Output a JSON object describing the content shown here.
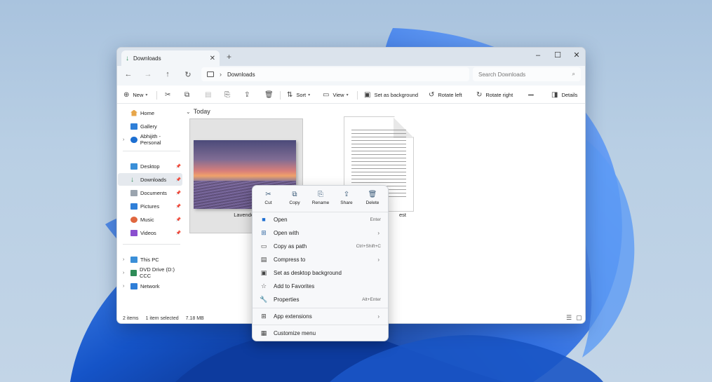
{
  "window": {
    "tab_title": "Downloads",
    "close_tab": "✕",
    "new_tab": "+",
    "minimize": "–",
    "maximize": "☐",
    "close": "✕"
  },
  "nav": {
    "back": "←",
    "forward": "→",
    "up": "↑",
    "refresh": "↻",
    "path_sep": "›",
    "breadcrumb": "Downloads",
    "search_placeholder": "Search Downloads",
    "search_icon": "⌕"
  },
  "toolbar": {
    "new_label": "New",
    "sort_label": "Sort",
    "view_label": "View",
    "set_background_label": "Set as background",
    "rotate_left_label": "Rotate left",
    "rotate_right_label": "Rotate right",
    "more_label": "•••",
    "details_label": "Details"
  },
  "sidebar": {
    "home": "Home",
    "gallery": "Gallery",
    "onedrive": "Abhijith - Personal",
    "desktop": "Desktop",
    "downloads": "Downloads",
    "documents": "Documents",
    "pictures": "Pictures",
    "music": "Music",
    "videos": "Videos",
    "this_pc": "This PC",
    "dvd": "DVD Drive (D:) CCC",
    "network": "Network"
  },
  "content": {
    "group": "Today",
    "file1_label": "Lavender f",
    "file2_label": "est"
  },
  "status": {
    "items": "2 items",
    "selected": "1 item selected",
    "size": "7.18 MB"
  },
  "context_menu": {
    "quick_actions": [
      "Cut",
      "Copy",
      "Rename",
      "Share",
      "Delete"
    ],
    "open": "Open",
    "open_sc": "Enter",
    "open_with": "Open with",
    "copy_path": "Copy as path",
    "copy_path_sc": "Ctrl+Shift+C",
    "compress": "Compress to",
    "set_desktop_bg": "Set as desktop background",
    "add_favorites": "Add to Favorites",
    "properties": "Properties",
    "properties_sc": "Alt+Enter",
    "app_extensions": "App extensions",
    "customize": "Customize menu"
  },
  "colors": {
    "accent": "#0a64c8",
    "wallpaper_light": "#b9cfe4",
    "bloom_dark": "#0b3fa8"
  }
}
